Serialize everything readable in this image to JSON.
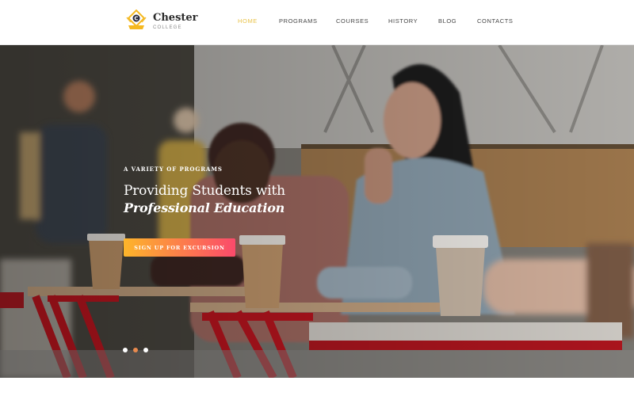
{
  "brand": {
    "name": "Chester",
    "subtitle": "COLLEGE",
    "logo_letter": "C",
    "icon": "college-crest-icon"
  },
  "nav": {
    "items": [
      {
        "label": "HOME",
        "active": true
      },
      {
        "label": "PROGRAMS",
        "active": false
      },
      {
        "label": "COURSES",
        "active": false
      },
      {
        "label": "HISTORY",
        "active": false
      },
      {
        "label": "BLOG",
        "active": false
      },
      {
        "label": "CONTACTS",
        "active": false
      }
    ]
  },
  "hero": {
    "eyebrow": "A VARIETY OF PROGRAMS",
    "headline_line1": "Providing Students with",
    "headline_line2": "Professional Education",
    "cta_label": "SIGN UP FOR EXCURSION",
    "slider": {
      "total": 3,
      "active_index": 1
    }
  },
  "colors": {
    "accent_yellow": "#e9c34a",
    "cta_gradient_start": "#fdb52a",
    "cta_gradient_end": "#fb4a6b",
    "active_dot": "#e88a4e"
  }
}
